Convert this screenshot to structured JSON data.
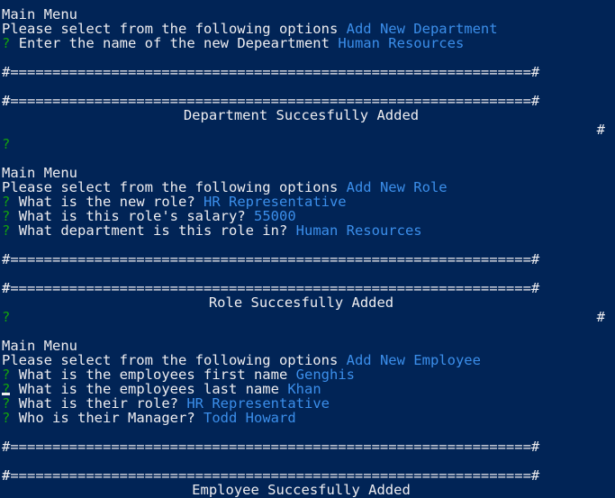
{
  "colors": {
    "background": "#012456",
    "text": "#eeedf0",
    "prompt": "#13a10e",
    "answer": "#3b8eea"
  },
  "block1": {
    "menu_title": "Main Menu",
    "select_prompt": "Please select from the following options",
    "select_answer": "Add New Department",
    "q_mark": "?",
    "q1_text": "Enter the name of the new Depeartment",
    "q1_answer": "Human Resources",
    "rule_top": "#==============================================================#",
    "banner_hash_left": "#",
    "banner_text": "Department Succesfully Added",
    "banner_hash_right": "#",
    "rule_bottom": "#==============================================================#",
    "trailing_prompt": "?"
  },
  "block2": {
    "menu_title": "Main Menu",
    "select_prompt": "Please select from the following options",
    "select_answer": "Add New Role",
    "q_mark": "?",
    "q1_text": "What is the new role?",
    "q1_answer": "HR Representative",
    "q2_text": "What is this role's salary?",
    "q2_answer": "55000",
    "q3_text": "What department is this role in?",
    "q3_answer": "Human Resources",
    "rule_top": "#==============================================================#",
    "banner_hash_left": "#",
    "banner_text": "Role Succesfully Added",
    "banner_hash_right": "#",
    "rule_bottom": "#==============================================================#",
    "trailing_prompt": "?"
  },
  "block3": {
    "menu_title": "Main Menu",
    "select_prompt": "Please select from the following options",
    "select_answer": "Add New Employee",
    "q_mark": "?",
    "q1_text": "What is the employees first name",
    "q1_answer": "Genghis",
    "q2_text": "What is the employees last name",
    "q2_answer": "Khan",
    "q3_text": "What is their role?",
    "q3_answer": "HR Representative",
    "q4_text": "Who is their Manager?",
    "q4_answer": "Todd Howard",
    "rule_top": "#==============================================================#",
    "banner_hash_left": "#",
    "banner_text": "Employee Succesfully Added",
    "banner_hash_right": "#",
    "rule_bottom": "#==============================================================#"
  }
}
